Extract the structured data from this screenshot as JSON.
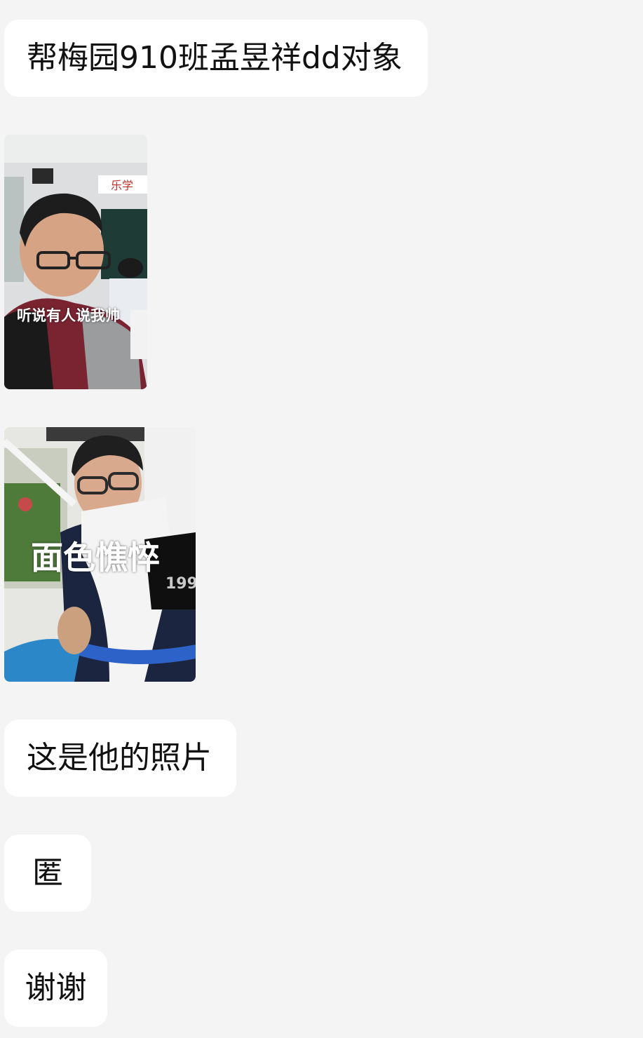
{
  "messages": [
    {
      "type": "text",
      "text": "帮梅园910班孟昱祥dd对象"
    },
    {
      "type": "image",
      "description_icon": "photo-boy-classroom",
      "overlay_caption": "听说有人说我帅",
      "wall_sign": "乐学"
    },
    {
      "type": "image",
      "description_icon": "photo-boy-jacket",
      "overlay_caption": "面色憔悴",
      "shirt_text": "199"
    },
    {
      "type": "text",
      "text": "这是他的照片"
    },
    {
      "type": "text",
      "text": "匿"
    },
    {
      "type": "text",
      "text": "谢谢"
    }
  ],
  "colors": {
    "background": "#f4f4f4",
    "bubble": "#ffffff",
    "text": "#111111"
  }
}
